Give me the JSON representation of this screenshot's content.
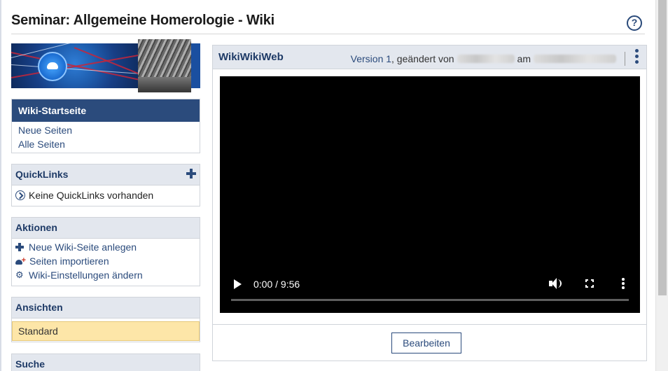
{
  "header": {
    "title": "Seminar: Allgemeine Homerologie - Wiki",
    "help_icon": "?"
  },
  "nav": {
    "active": "Wiki-Startseite",
    "items": [
      "Neue Seiten",
      "Alle Seiten"
    ]
  },
  "quicklinks": {
    "title": "QuickLinks",
    "empty": "Keine QuickLinks vorhanden"
  },
  "actions": {
    "title": "Aktionen",
    "items": [
      "Neue Wiki-Seite anlegen",
      "Seiten importieren",
      "Wiki-Einstellungen ändern"
    ]
  },
  "views": {
    "title": "Ansichten",
    "selected": "Standard"
  },
  "search": {
    "title": "Suche"
  },
  "wiki": {
    "page_title": "WikiWikiWeb",
    "version_link": "Version 1",
    "changed_by": ", geändert von",
    "at": "am",
    "video_time": "0:00 / 9:56",
    "progress": 0,
    "edit_button": "Bearbeiten"
  },
  "colors": {
    "accent": "#2b4b7c",
    "panel_header": "#e3e7ee",
    "selected_view": "#fde6a8"
  },
  "icons": [
    "help-icon",
    "plus-icon",
    "circle-arrow-icon",
    "gear-icon",
    "play-icon",
    "volume-icon",
    "fullscreen-icon",
    "more-vertical-icon"
  ]
}
